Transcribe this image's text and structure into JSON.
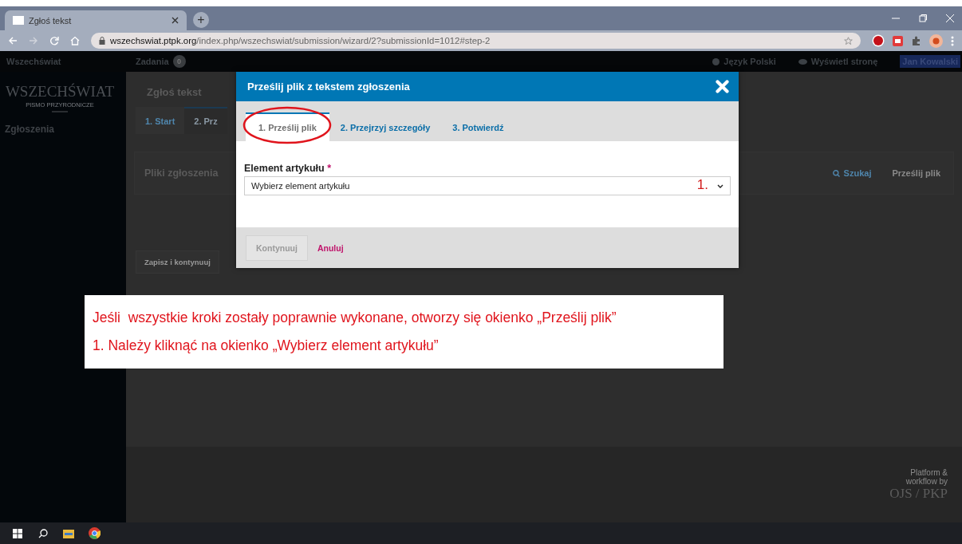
{
  "browser": {
    "tab_title": "Zgłoś tekst",
    "new_tab": "+",
    "url_host": "wszechswiat.ptpk.org",
    "url_path": "/index.php/wszechswiat/submission/wizard/2?submissionId=1012#step-2"
  },
  "app": {
    "site_name": "Wszechświat",
    "tasks_label": "Zadania",
    "tasks_count": "0",
    "language": "Język Polski",
    "view_site": "Wyświetl stronę",
    "user": "Jan Kowalski",
    "logo_title": "WSZECHŚWIAT",
    "logo_subtitle": "PISMO PRZYRODNICZE",
    "sidebar_items": [
      {
        "label": "Zgłoszenia"
      }
    ],
    "page_title": "Zgłoś tekst",
    "steps": [
      {
        "label": "1. Start",
        "selected": false
      },
      {
        "label": "2. Prz",
        "selected": true
      }
    ],
    "files_panel": {
      "title": "Pliki zgłoszenia",
      "search": "Szukaj",
      "upload": "Prześlij plik"
    },
    "save_button": "Zapisz i kontynuuj",
    "footer": {
      "line1": "Platform &",
      "line2": "workflow by",
      "logo": "OJS / PKP"
    }
  },
  "modal": {
    "title": "Prześlij plik z tekstem zgłoszenia",
    "tabs": [
      {
        "label": "1. Prześlij plik",
        "selected": true
      },
      {
        "label": "2. Przejrzyj szczegóły",
        "selected": false
      },
      {
        "label": "3. Potwierdź",
        "selected": false
      }
    ],
    "field_label": "Element artykułu",
    "required_mark": "*",
    "select_placeholder": "Wybierz element artykułu",
    "annotation_number": "1.",
    "continue_button": {
      "label": "Kontynuuj",
      "disabled": true
    },
    "cancel": "Anuluj"
  },
  "note": {
    "lines": [
      "Jeśli  wszystkie kroki zostały poprawnie wykonane, otworzy się okienko „Prześlij plik”",
      "1. Należy kliknąć na okienko „Wybierz element artykułu”"
    ]
  }
}
